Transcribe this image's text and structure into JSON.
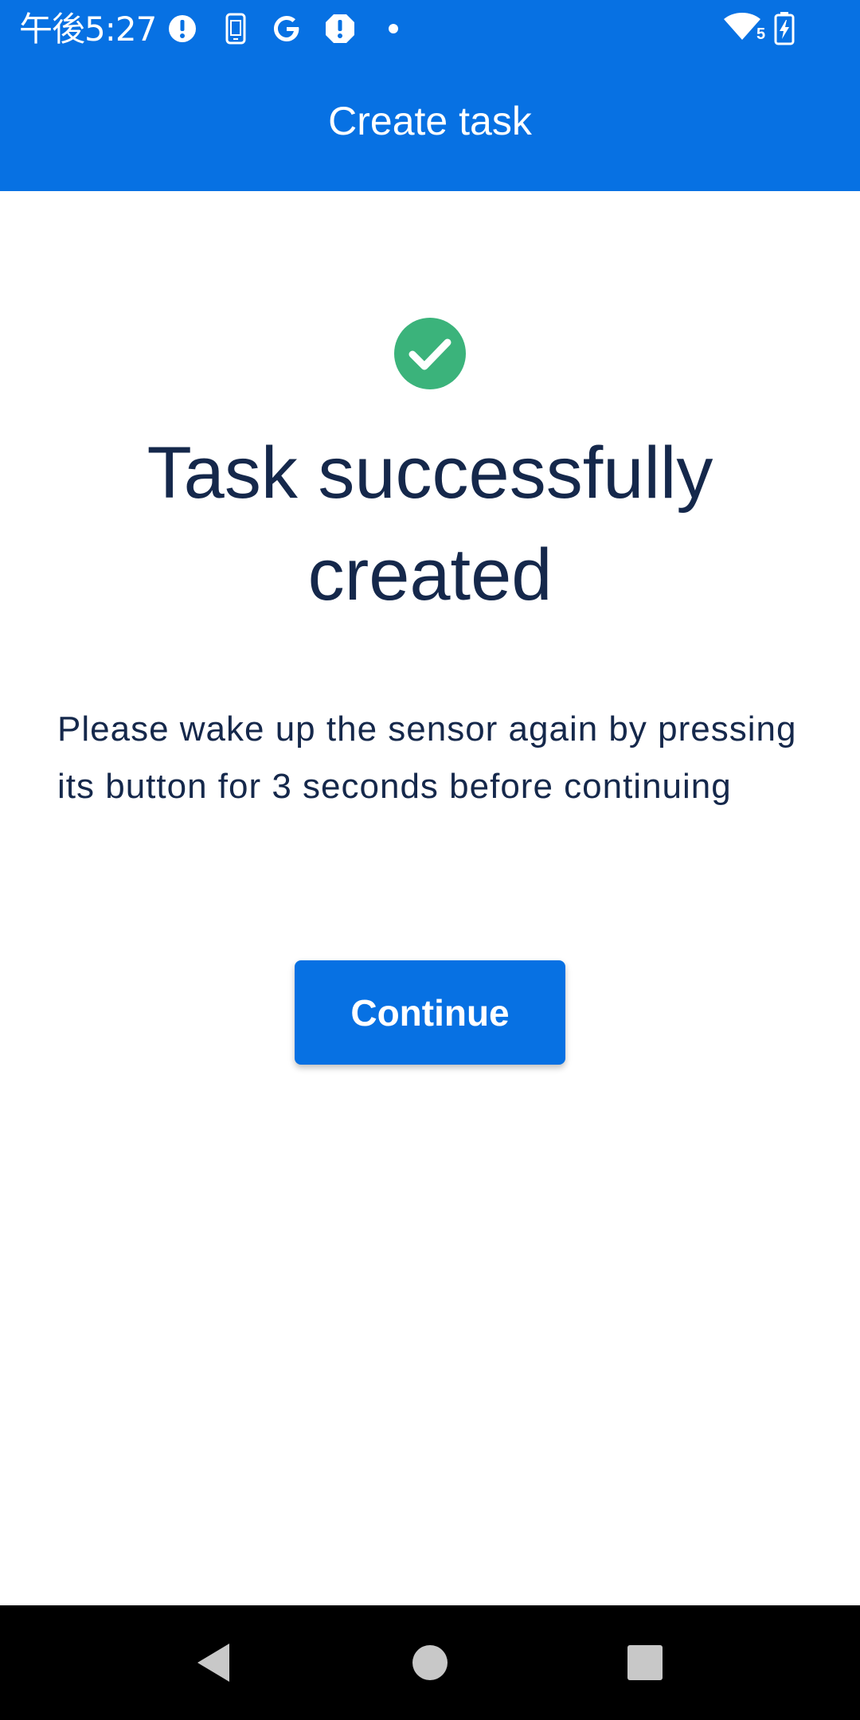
{
  "status_bar": {
    "time": "午後5:27",
    "icons": [
      "alert-circle-icon",
      "phone-sync-icon",
      "google-icon",
      "alert-octagon-icon",
      "dot-icon",
      "wifi-icon",
      "battery-charging-icon"
    ],
    "wifi_badge": "5"
  },
  "app_bar": {
    "title": "Create task"
  },
  "content": {
    "icon": "check-circle-icon",
    "title_line1": "Task successfully",
    "title_line2": "created",
    "instruction": "Please wake up the sensor again by pressing its button for 3 seconds before continuing",
    "continue_label": "Continue"
  },
  "nav_bar": {
    "buttons": [
      "back-icon",
      "home-icon",
      "recents-icon"
    ]
  },
  "colors": {
    "primary": "#0771e3",
    "success": "#3bb37b",
    "text_dark": "#15284b",
    "nav_background": "#000000",
    "nav_icon": "#c8c8c8"
  }
}
